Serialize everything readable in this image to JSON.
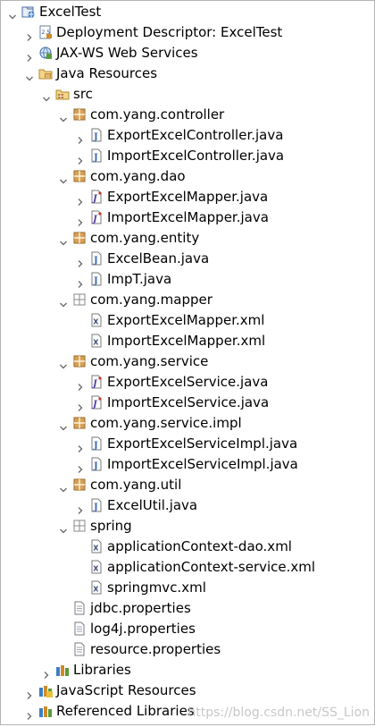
{
  "tree": [
    {
      "depth": 0,
      "twisty": "expanded",
      "icon": "project-icon",
      "label": "ExcelTest"
    },
    {
      "depth": 1,
      "twisty": "collapsed",
      "icon": "deployment-descriptor-icon",
      "label": "Deployment Descriptor: ExcelTest"
    },
    {
      "depth": 1,
      "twisty": "collapsed",
      "icon": "web-services-icon",
      "label": "JAX-WS Web Services"
    },
    {
      "depth": 1,
      "twisty": "expanded",
      "icon": "java-resources-icon",
      "label": "Java Resources"
    },
    {
      "depth": 2,
      "twisty": "expanded",
      "icon": "source-folder-icon",
      "label": "src"
    },
    {
      "depth": 3,
      "twisty": "expanded",
      "icon": "package-icon",
      "label": "com.yang.controller"
    },
    {
      "depth": 4,
      "twisty": "collapsed",
      "icon": "java-file-icon",
      "label": "ExportExcelController.java"
    },
    {
      "depth": 4,
      "twisty": "collapsed",
      "icon": "java-file-icon",
      "label": "ImportExcelController.java"
    },
    {
      "depth": 3,
      "twisty": "expanded",
      "icon": "package-icon",
      "label": "com.yang.dao"
    },
    {
      "depth": 4,
      "twisty": "collapsed",
      "icon": "java-interface-file-icon",
      "label": "ExportExcelMapper.java"
    },
    {
      "depth": 4,
      "twisty": "collapsed",
      "icon": "java-interface-file-icon",
      "label": "ImportExcelMapper.java"
    },
    {
      "depth": 3,
      "twisty": "expanded",
      "icon": "package-icon",
      "label": "com.yang.entity"
    },
    {
      "depth": 4,
      "twisty": "collapsed",
      "icon": "java-file-icon",
      "label": "ExcelBean.java"
    },
    {
      "depth": 4,
      "twisty": "collapsed",
      "icon": "java-file-icon",
      "label": "ImpT.java"
    },
    {
      "depth": 3,
      "twisty": "expanded",
      "icon": "package-icon-empty",
      "label": "com.yang.mapper"
    },
    {
      "depth": 4,
      "twisty": "none",
      "icon": "xml-file-icon",
      "label": "ExportExcelMapper.xml"
    },
    {
      "depth": 4,
      "twisty": "none",
      "icon": "xml-file-icon",
      "label": "ImportExcelMapper.xml"
    },
    {
      "depth": 3,
      "twisty": "expanded",
      "icon": "package-icon",
      "label": "com.yang.service"
    },
    {
      "depth": 4,
      "twisty": "collapsed",
      "icon": "java-interface-file-icon",
      "label": "ExportExcelService.java"
    },
    {
      "depth": 4,
      "twisty": "collapsed",
      "icon": "java-interface-file-icon",
      "label": "ImportExcelService.java"
    },
    {
      "depth": 3,
      "twisty": "expanded",
      "icon": "package-icon",
      "label": "com.yang.service.impl"
    },
    {
      "depth": 4,
      "twisty": "collapsed",
      "icon": "java-file-icon",
      "label": "ExportExcelServiceImpl.java"
    },
    {
      "depth": 4,
      "twisty": "collapsed",
      "icon": "java-file-icon",
      "label": "ImportExcelServiceImpl.java"
    },
    {
      "depth": 3,
      "twisty": "expanded",
      "icon": "package-icon",
      "label": "com.yang.util"
    },
    {
      "depth": 4,
      "twisty": "collapsed",
      "icon": "java-file-icon",
      "label": "ExcelUtil.java"
    },
    {
      "depth": 3,
      "twisty": "expanded",
      "icon": "package-icon-empty",
      "label": "spring"
    },
    {
      "depth": 4,
      "twisty": "none",
      "icon": "xml-file-icon",
      "label": "applicationContext-dao.xml"
    },
    {
      "depth": 4,
      "twisty": "none",
      "icon": "xml-file-icon",
      "label": "applicationContext-service.xml"
    },
    {
      "depth": 4,
      "twisty": "none",
      "icon": "xml-file-icon",
      "label": "springmvc.xml"
    },
    {
      "depth": 3,
      "twisty": "none",
      "icon": "properties-file-icon",
      "label": "jdbc.properties"
    },
    {
      "depth": 3,
      "twisty": "none",
      "icon": "properties-file-icon",
      "label": "log4j.properties"
    },
    {
      "depth": 3,
      "twisty": "none",
      "icon": "properties-file-icon",
      "label": "resource.properties"
    },
    {
      "depth": 2,
      "twisty": "collapsed",
      "icon": "libraries-icon",
      "label": "Libraries"
    },
    {
      "depth": 1,
      "twisty": "collapsed",
      "icon": "javascript-resources-icon",
      "label": "JavaScript Resources"
    },
    {
      "depth": 1,
      "twisty": "collapsed",
      "icon": "referenced-libraries-icon",
      "label": "Referenced Libraries"
    }
  ],
  "watermark": "https://blog.csdn.net/SS_Lion",
  "colors": {
    "twisty": "#6e6e6e",
    "package": "#b57d35",
    "java": "#3b6bb5",
    "xml": "#5b6fa0",
    "watermark": "#c8c8c8"
  }
}
